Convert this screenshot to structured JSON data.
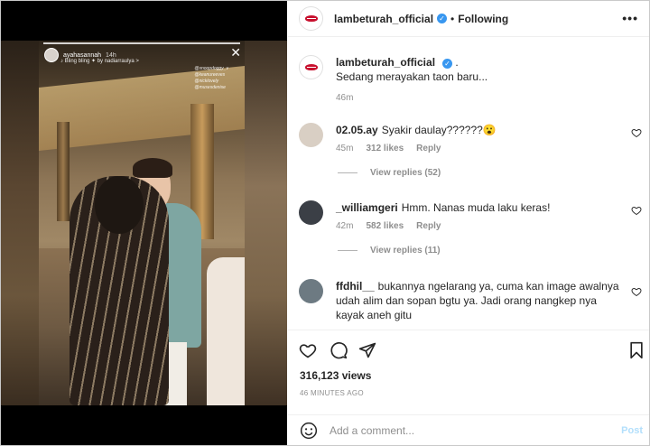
{
  "story": {
    "username": "ayahasannah",
    "time": "14h",
    "music": "♪ Bling bling ✦ by nadiarraulya >",
    "tags": [
      "@snoopdoggy_v",
      "@keanureeves",
      "@nicklovely",
      "@musesdenise"
    ]
  },
  "header": {
    "username": "lambeturah_official",
    "separator": "•",
    "follow_state": "Following",
    "more": "•••"
  },
  "caption": {
    "username": "lambeturah_official",
    "suffix": ".",
    "text": "Sedang merayakan taon baru...",
    "time": "46m"
  },
  "comments": [
    {
      "username": "02.05.ay",
      "text": "Syakir daulay??????😮",
      "time": "45m",
      "likes": "312 likes",
      "reply_label": "Reply",
      "view_replies": "View replies (52)",
      "avatar_color": "#d9cfc4"
    },
    {
      "username": "_williamgeri",
      "text": "Hmm. Nanas muda laku keras!",
      "time": "42m",
      "likes": "582 likes",
      "reply_label": "Reply",
      "view_replies": "View replies (11)",
      "avatar_color": "#3b3f46"
    },
    {
      "username": "ffdhil__",
      "text": "bukannya ngelarang ya, cuma kan image awalnya udah alim dan sopan bgtu ya. Jadi orang nangkep nya kayak aneh gitu",
      "avatar_color": "#6d7a82"
    }
  ],
  "stats": {
    "views": "316,123 views",
    "ago": "46 MINUTES AGO"
  },
  "add_comment": {
    "placeholder": "Add a comment...",
    "post_label": "Post"
  }
}
